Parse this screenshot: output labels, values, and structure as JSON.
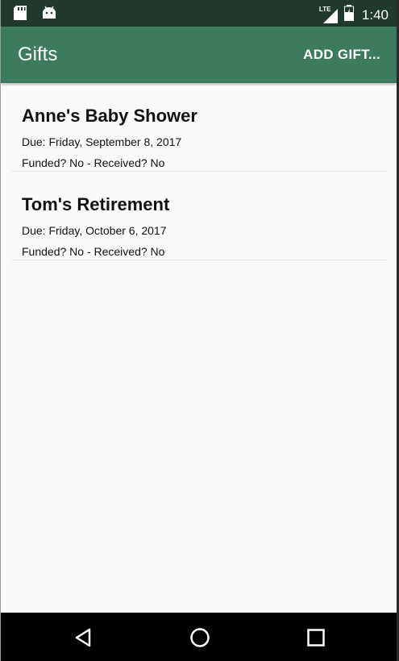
{
  "status_bar": {
    "left_icons": [
      "sd-card-icon",
      "android-icon"
    ],
    "network_label": "LTE",
    "time": "1:40"
  },
  "app_bar": {
    "title": "Gifts",
    "action_label": "ADD GIFT..."
  },
  "gifts": [
    {
      "name": "Anne's Baby Shower",
      "due": "Due: Friday, September 8, 2017",
      "status": "Funded? No - Received? No"
    },
    {
      "name": "Tom's Retirement",
      "due": "Due: Friday, October 6, 2017",
      "status": "Funded? No - Received? No"
    }
  ],
  "nav_bar": {
    "buttons": [
      "back-icon",
      "home-icon",
      "recents-icon"
    ]
  },
  "colors": {
    "status_bar": "#1f3a2c",
    "app_bar": "#3d7a5e",
    "background": "#fafafa",
    "nav_bar": "#000000"
  }
}
